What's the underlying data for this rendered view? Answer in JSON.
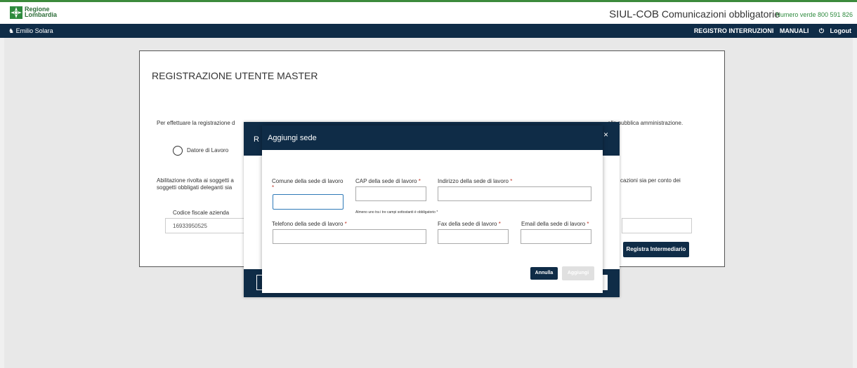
{
  "brand": {
    "logo_text_line1": "Regione",
    "logo_text_line2": "Lombardia"
  },
  "header": {
    "app_name": "SIUL-COB",
    "app_subtitle": "Comunicazioni obbligatorie",
    "numero_verde": "Numero verde 800 591 826"
  },
  "navbar": {
    "user_name": "Emilio Solara",
    "links": [
      "REGISTRO INTERRUZIONI",
      "MANUALI",
      "Logout"
    ]
  },
  "card": {
    "title": "REGISTRAZIONE UTENTE MASTER",
    "text1_start": "Per effettuare la registrazione d",
    "text1_end": "ella pubblica amministrazione.",
    "radio_label": "Datore di Lavoro",
    "text2_start_line1": "Abilitazione rivolta ai soggetti a",
    "text2_start_line2": "soggetti obbligati deleganti sia",
    "text2_end": "cazioni sia per conto dei",
    "cf_label": "Codice fiscale azienda",
    "cf_value": "16933950525",
    "registra_button": "Registra Intermediario"
  },
  "modal_back": {
    "title_fragment": "R",
    "close": "×"
  },
  "modal": {
    "title": "Aggiungi sede",
    "fields": {
      "comune": "Comune della sede di lavoro",
      "cap": "CAP della sede di lavoro",
      "indirizzo": "Indirizzo della sede di lavoro",
      "telefono": "Telefono della sede di lavoro",
      "fax": "Fax della sede di lavoro",
      "email": "Email della sede di lavoro"
    },
    "required_marker": "*",
    "hint": "Almeno uno tra i tre campi sottostanti è obbligatorio *",
    "annulla": "Annulla",
    "aggiungi": "Aggiungi"
  }
}
